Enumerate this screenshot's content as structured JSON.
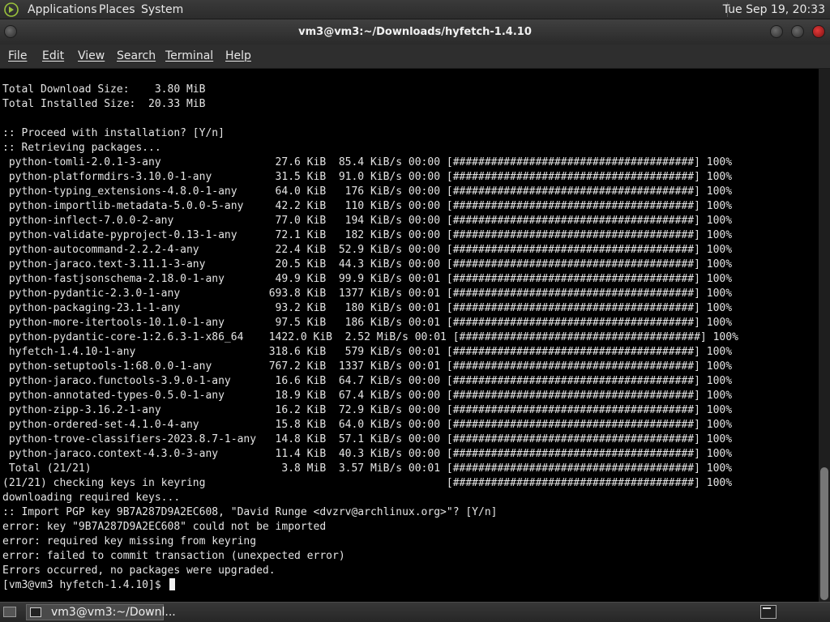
{
  "top_panel": {
    "menus": [
      "Applications",
      "Places",
      "System"
    ],
    "clock": "Tue Sep 19, 20:33"
  },
  "window": {
    "title": "vm3@vm3:~/Downloads/hyfetch-1.4.10"
  },
  "menubar": {
    "items": [
      "File",
      "Edit",
      "View",
      "Search",
      "Terminal",
      "Help"
    ]
  },
  "terminal": {
    "lines": [
      "Total Download Size:    3.80 MiB",
      "Total Installed Size:  20.33 MiB",
      "",
      ":: Proceed with installation? [Y/n]",
      ":: Retrieving packages...",
      " python-tomli-2.0.1-3-any                  27.6 KiB  85.4 KiB/s 00:00 [######################################] 100%",
      " python-platformdirs-3.10.0-1-any          31.5 KiB  91.0 KiB/s 00:00 [######################################] 100%",
      " python-typing_extensions-4.8.0-1-any      64.0 KiB   176 KiB/s 00:00 [######################################] 100%",
      " python-importlib-metadata-5.0.0-5-any     42.2 KiB   110 KiB/s 00:00 [######################################] 100%",
      " python-inflect-7.0.0-2-any                77.0 KiB   194 KiB/s 00:00 [######################################] 100%",
      " python-validate-pyproject-0.13-1-any      72.1 KiB   182 KiB/s 00:00 [######################################] 100%",
      " python-autocommand-2.2.2-4-any            22.4 KiB  52.9 KiB/s 00:00 [######################################] 100%",
      " python-jaraco.text-3.11.1-3-any           20.5 KiB  44.3 KiB/s 00:00 [######################################] 100%",
      " python-fastjsonschema-2.18.0-1-any        49.9 KiB  99.9 KiB/s 00:01 [######################################] 100%",
      " python-pydantic-2.3.0-1-any              693.8 KiB  1377 KiB/s 00:01 [######################################] 100%",
      " python-packaging-23.1-1-any               93.2 KiB   180 KiB/s 00:01 [######################################] 100%",
      " python-more-itertools-10.1.0-1-any        97.5 KiB   186 KiB/s 00:01 [######################################] 100%",
      " python-pydantic-core-1:2.6.3-1-x86_64    1422.0 KiB  2.52 MiB/s 00:01 [######################################] 100%",
      " hyfetch-1.4.10-1-any                     318.6 KiB   579 KiB/s 00:01 [######################################] 100%",
      " python-setuptools-1:68.0.0-1-any         767.2 KiB  1337 KiB/s 00:01 [######################################] 100%",
      " python-jaraco.functools-3.9.0-1-any       16.6 KiB  64.7 KiB/s 00:00 [######################################] 100%",
      " python-annotated-types-0.5.0-1-any        18.9 KiB  67.4 KiB/s 00:00 [######################################] 100%",
      " python-zipp-3.16.2-1-any                  16.2 KiB  72.9 KiB/s 00:00 [######################################] 100%",
      " python-ordered-set-4.1.0-4-any            15.8 KiB  64.0 KiB/s 00:00 [######################################] 100%",
      " python-trove-classifiers-2023.8.7-1-any   14.8 KiB  57.1 KiB/s 00:00 [######################################] 100%",
      " python-jaraco.context-4.3.0-3-any         11.4 KiB  40.3 KiB/s 00:00 [######################################] 100%",
      " Total (21/21)                              3.8 MiB  3.57 MiB/s 00:01 [######################################] 100%",
      "(21/21) checking keys in keyring                                      [######################################] 100%",
      "downloading required keys...",
      ":: Import PGP key 9B7A287D9A2EC608, \"David Runge <dvzrv@archlinux.org>\"? [Y/n]",
      "error: key \"9B7A287D9A2EC608\" could not be imported",
      "error: required key missing from keyring",
      "error: failed to commit transaction (unexpected error)",
      "Errors occurred, no packages were upgraded."
    ],
    "prompt": "[vm3@vm3 hyfetch-1.4.10]$ "
  },
  "taskbar": {
    "item_label": "vm3@vm3:~/Downl..."
  }
}
